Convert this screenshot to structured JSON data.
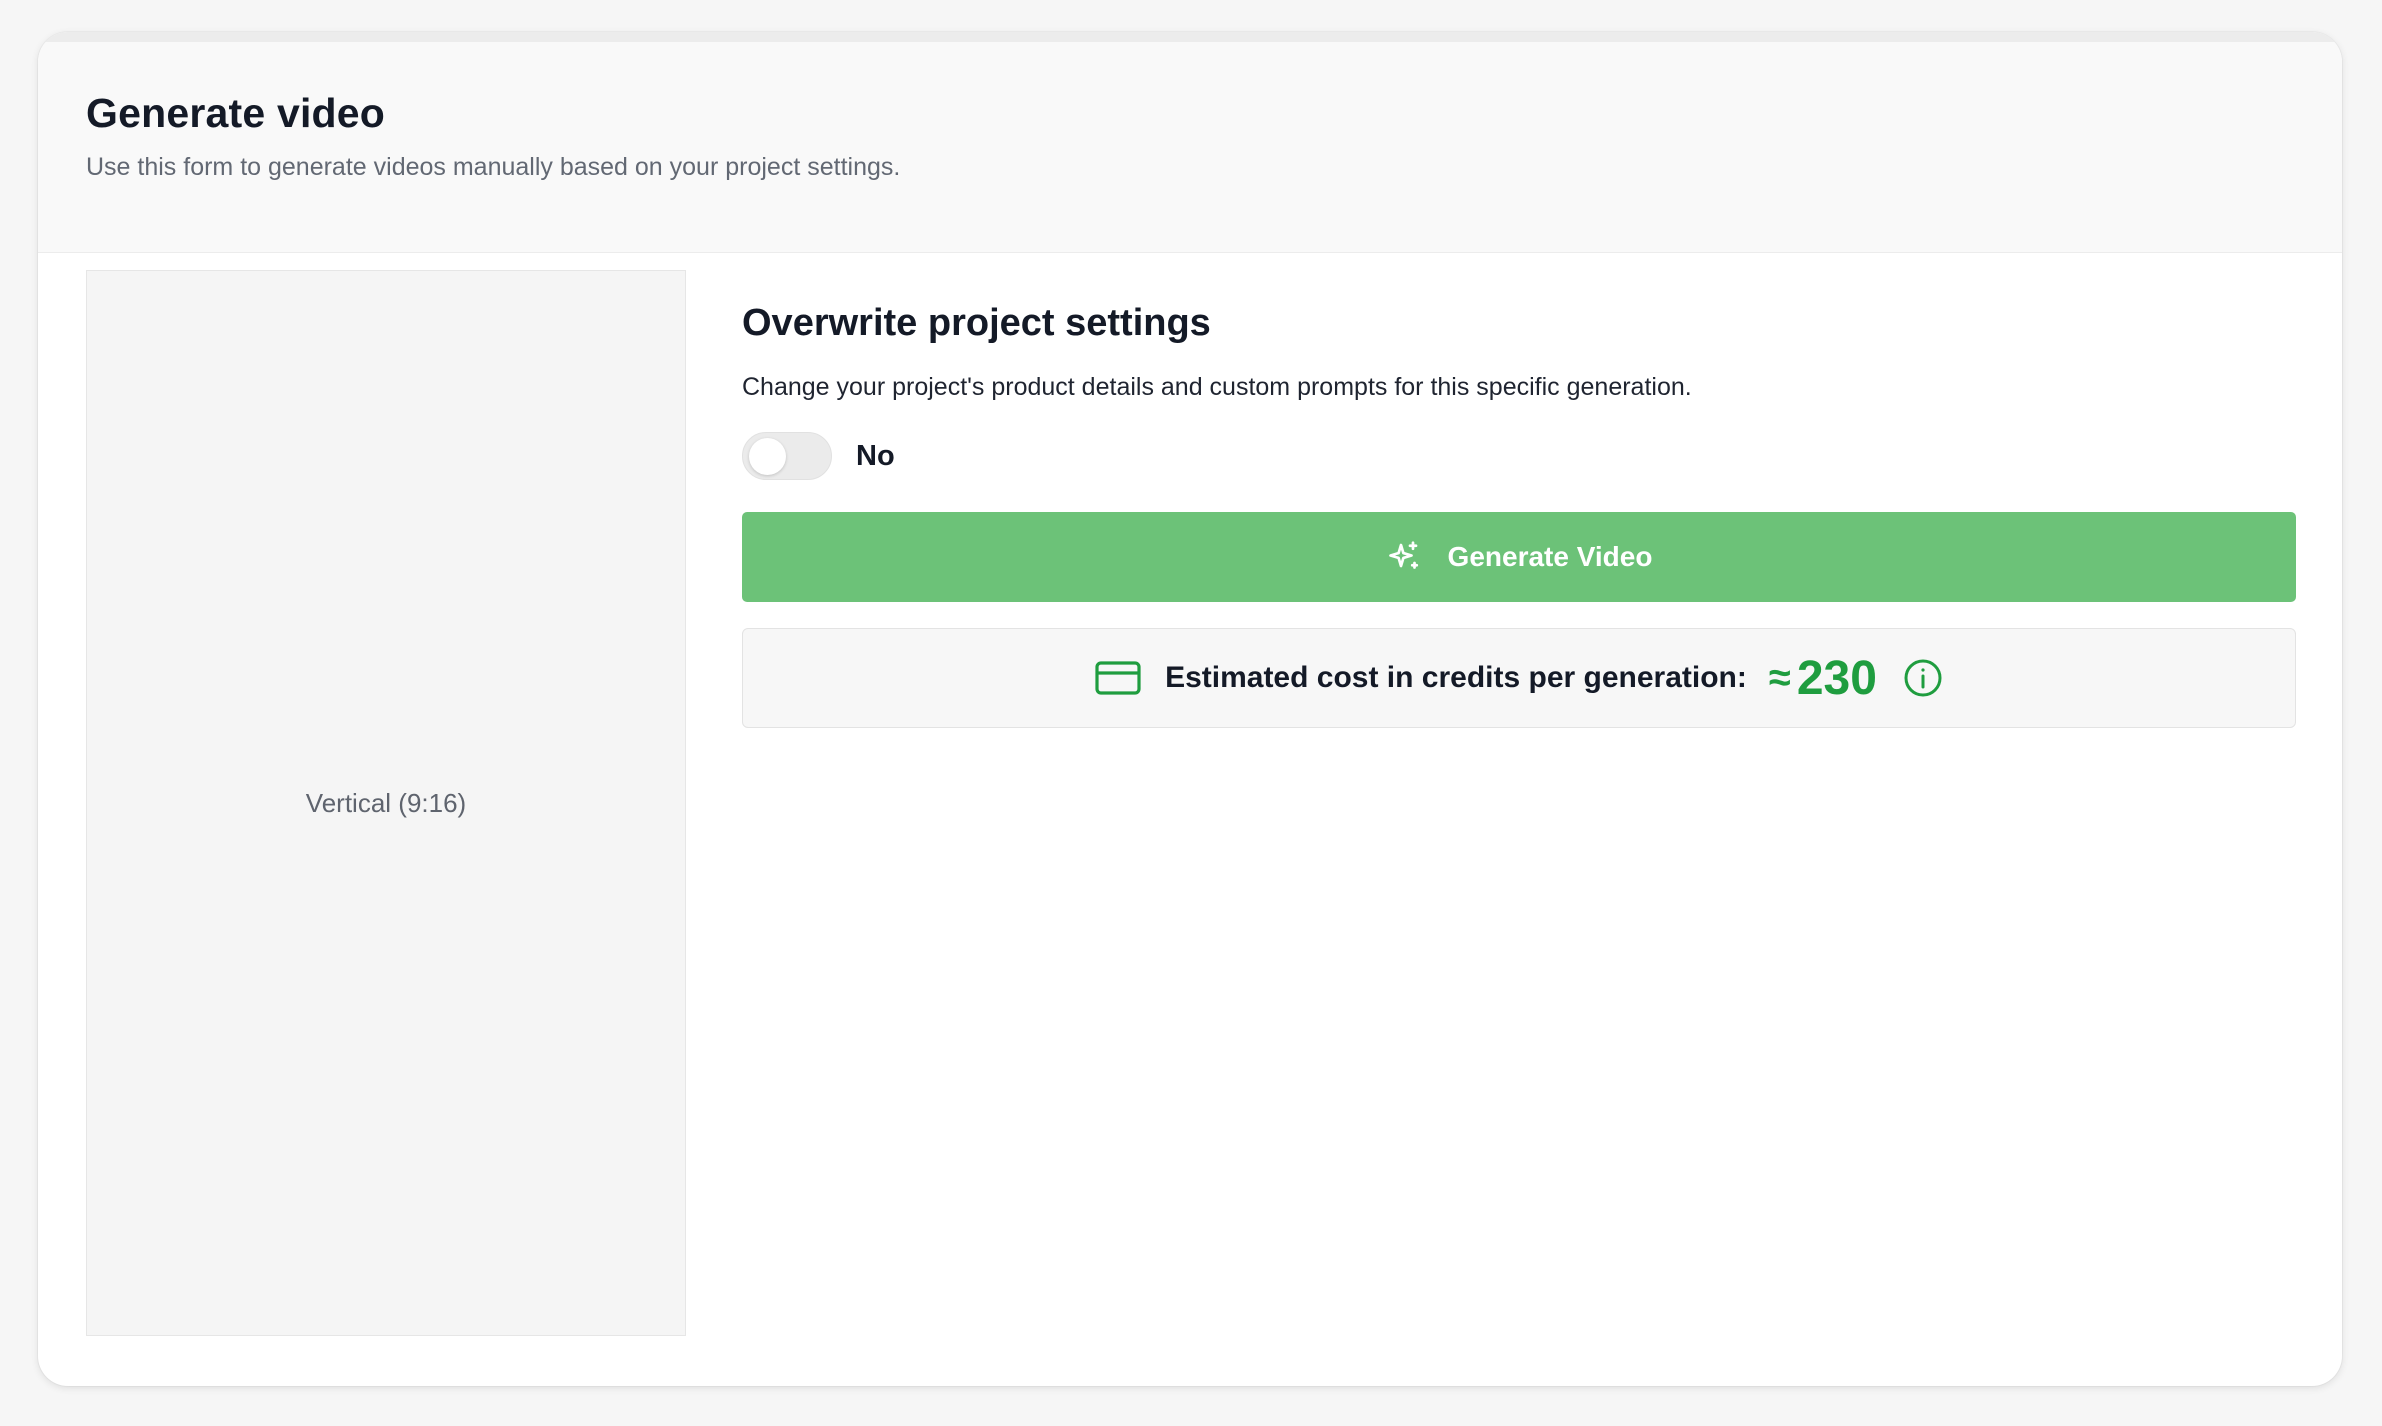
{
  "header": {
    "title": "Generate video",
    "subtitle": "Use this form to generate videos manually based on your project settings."
  },
  "preview": {
    "label": "Vertical (9:16)"
  },
  "settings": {
    "title": "Overwrite project settings",
    "description": "Change your project's product details and custom prompts for this specific generation.",
    "toggle": {
      "label": "No",
      "checked": false
    }
  },
  "generate_button": {
    "label": "Generate Video",
    "icon": "sparkles-icon",
    "color": "#6cc278"
  },
  "cost": {
    "label": "Estimated cost in credits per generation:",
    "approx_symbol": "≈",
    "value": "230",
    "icon": "credit-card-icon",
    "info_icon": "info-icon",
    "accent_color": "#1f9d3f"
  }
}
